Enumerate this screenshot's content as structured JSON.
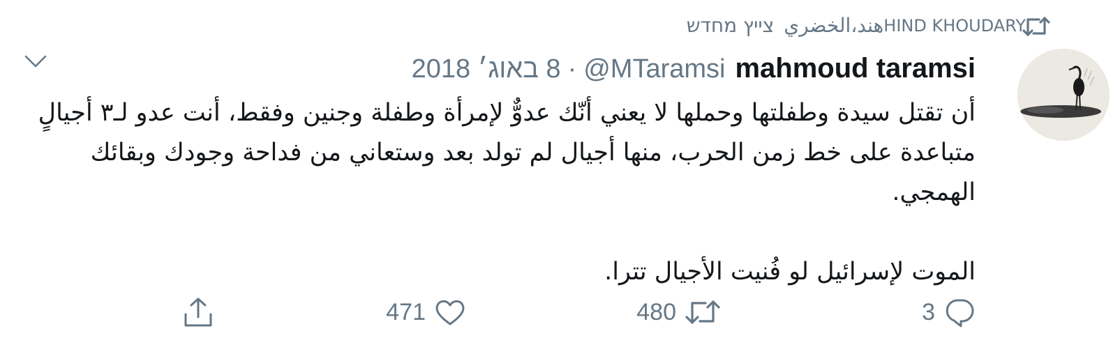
{
  "context": {
    "name_en": "HIND KHOUDARY",
    "name_ar": "هند،الخضري",
    "action": "צייץ מחדש",
    "icon": "retweet-icon"
  },
  "author": {
    "display_name": "mahmoud taramsi",
    "handle": "@MTaramsi",
    "separator": "·",
    "date": "8 באוג׳ 2018",
    "avatar": "avatar-image"
  },
  "text": {
    "paragraph1": "أن تقتل سيدة وطفلتها وحملها لا يعني أنّك عدوٌّ لإمرأة وطفلة وجنين وفقط، أنت عدو لـ٣ أجيالٍ متباعدة على خط زمن الحرب، منها أجيال لم تولد بعد وستعاني من فداحة وجودك وبقائك الهمجي.",
    "paragraph2": "الموت لإسرائيل لو فُنيت الأجيال تترا."
  },
  "actions": {
    "reply": {
      "count": "3",
      "icon": "reply-icon"
    },
    "retweet": {
      "count": "480",
      "icon": "retweet-icon"
    },
    "like": {
      "count": "471",
      "icon": "heart-icon"
    },
    "share": {
      "icon": "share-icon"
    }
  },
  "colors": {
    "text": "#14171a",
    "secondary": "#657786"
  }
}
